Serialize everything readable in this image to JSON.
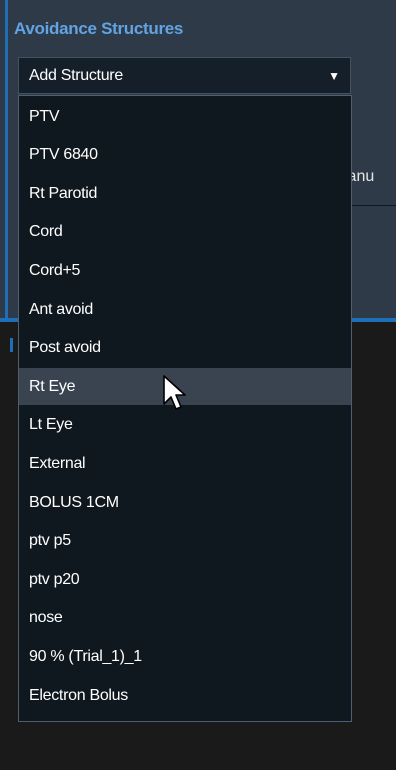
{
  "section_title": "Avoidance Structures",
  "background_partial_text": "lanu",
  "select": {
    "label": "Add Structure",
    "caret_icon": "caret-down-icon"
  },
  "dropdown": {
    "highlighted_index": 7,
    "options": [
      "PTV",
      "PTV 6840",
      "Rt Parotid",
      "Cord",
      "Cord+5",
      "Ant avoid",
      "Post avoid",
      "Rt Eye",
      "Lt Eye",
      "External",
      "BOLUS 1CM",
      "ptv p5",
      "ptv p20",
      "nose",
      "90 % (Trial_1)_1",
      "Electron Bolus"
    ]
  },
  "colors": {
    "accent": "#1f6fb8",
    "title": "#62a3e3",
    "panel_bg": "#2e3a48",
    "dropdown_bg": "#10181f",
    "highlight": "#3a4350"
  }
}
